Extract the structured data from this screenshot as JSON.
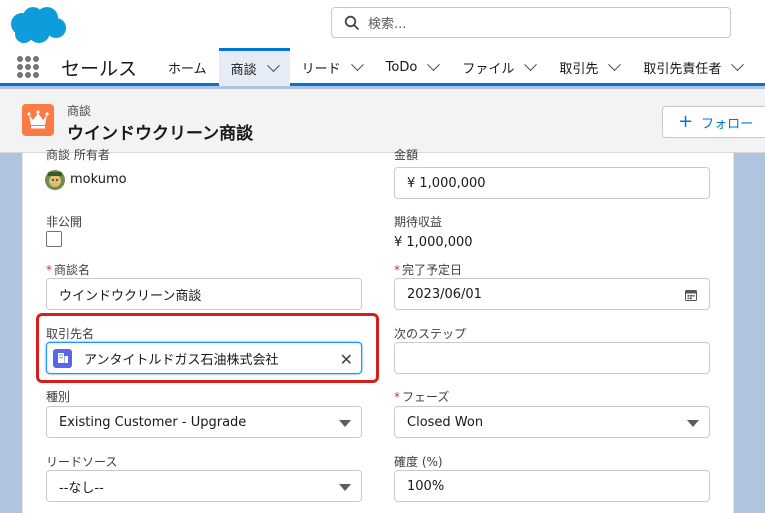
{
  "search": {
    "placeholder": "検索..."
  },
  "nav": {
    "app_name": "セールス",
    "tabs": [
      {
        "label": "ホーム",
        "has_menu": false,
        "active": false
      },
      {
        "label": "商談",
        "has_menu": true,
        "active": true
      },
      {
        "label": "リード",
        "has_menu": true,
        "active": false
      },
      {
        "label": "ToDo",
        "has_menu": true,
        "active": false
      },
      {
        "label": "ファイル",
        "has_menu": true,
        "active": false
      },
      {
        "label": "取引先",
        "has_menu": true,
        "active": false
      },
      {
        "label": "取引先責任者",
        "has_menu": true,
        "active": false
      }
    ]
  },
  "record": {
    "object_label": "商談",
    "title": "ウインドウクリーン商談",
    "follow_label": "フォロー"
  },
  "form": {
    "owner_label": "商談 所有者",
    "owner_value": "mokumo",
    "amount_label": "金額",
    "amount_value": "¥ 1,000,000",
    "private_label": "非公開",
    "expected_label": "期待収益",
    "expected_value": "¥ 1,000,000",
    "name_label": "商談名",
    "name_value": "ウインドウクリーン商談",
    "close_label": "完了予定日",
    "close_value": "2023/06/01",
    "account_label": "取引先名",
    "account_value": "アンタイトルドガス石油株式会社",
    "next_step_label": "次のステップ",
    "next_step_value": "",
    "type_label": "種別",
    "type_value": "Existing Customer - Upgrade",
    "stage_label": "フェーズ",
    "stage_value": "Closed Won",
    "lead_source_label": "リードソース",
    "lead_source_value": "--なし--",
    "probability_label": "確度 (%)",
    "probability_value": "100%",
    "required_mark": "*"
  },
  "colors": {
    "brand": "#0176d3",
    "opportunity_icon": "#fc7a43",
    "account_icon": "#5867e8",
    "highlight": "#d3201e"
  }
}
